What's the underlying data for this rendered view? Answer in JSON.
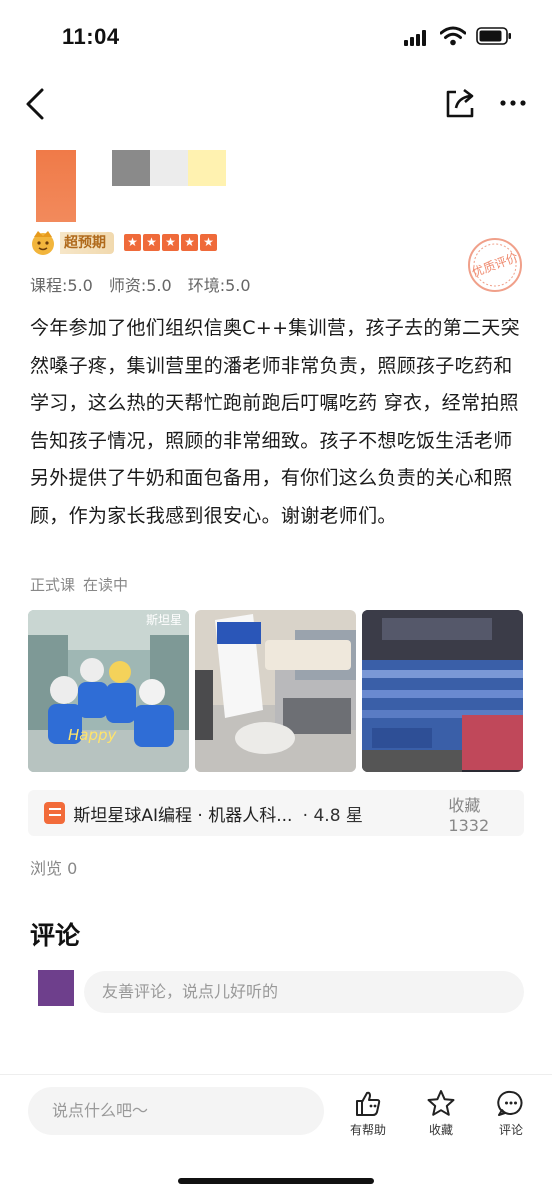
{
  "status_bar": {
    "time": "11:04"
  },
  "review": {
    "badge_label": "超预期",
    "stars": 5,
    "scores": [
      "课程:5.0",
      "师资:5.0",
      "环境:5.0"
    ],
    "stamp_text": "优质评价",
    "text": "今年参加了他们组织信奥C++集训营，孩子去的第二天突然嗓子疼，集训营里的潘老师非常负责，照顾孩子吃药和学习，这么热的天帮忙跑前跑后叮嘱吃药 穿衣，经常拍照告知孩子情况，照顾的非常细致。孩子不想吃饭生活老师另外提供了牛奶和面包备用，有你们这么负责的关心和照顾，作为家长我感到很安心。谢谢老师们。",
    "course_type": "正式课",
    "course_status": "在读中",
    "photo1_watermark": "斯坦星",
    "photo1_caption": "Happy"
  },
  "org": {
    "name": "斯坦星球AI编程 · 机器人科...",
    "rating": "· 4.8 星",
    "favorites": "收藏 1332"
  },
  "views": "浏览 0",
  "comments": {
    "title": "评论",
    "placeholder": "友善评论，说点儿好听的"
  },
  "bottom": {
    "input_placeholder": "说点什么吧～",
    "helpful_label": "有帮助",
    "favorite_label": "收藏",
    "comment_label": "评论"
  },
  "colors": {
    "accent": "#ef6a3a",
    "gold": "#b06a1c"
  }
}
